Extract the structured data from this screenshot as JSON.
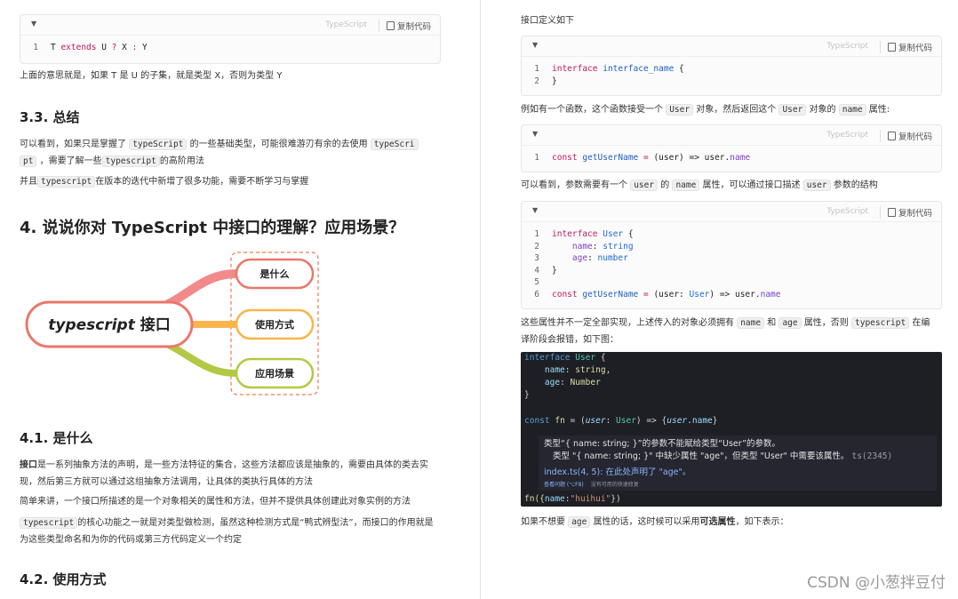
{
  "codeblock_common": {
    "lang": "TypeScript",
    "copy": "复制代码"
  },
  "left": {
    "code1": {
      "line_no": "1",
      "tokens": [
        "T ",
        "extends",
        " U ",
        "?",
        " X ",
        ":",
        " Y"
      ]
    },
    "p1": "上面的意思就是，如果 T 是 U 的子集，就是类型 X，否则为类型 Y",
    "h_3_3": "3.3. 总结",
    "p2_a": "可以看到，如果只是掌握了",
    "p2_code1": "typeScript",
    "p2_b": "的一些基础类型，可能很难游刃有余的去使用",
    "p2_code2a": "typeScri",
    "p2_code2b": "pt",
    "p2_c": "，需要了解一些",
    "p2_code3": "typescript",
    "p2_d": "的高阶用法",
    "p3_a": "并且",
    "p3_code": "typescript",
    "p3_b": "在版本的迭代中新增了很多功能，需要不断学习与掌握",
    "h_4": "4. 说说你对 TypeScript 中接口的理解？应用场景？",
    "mindmap": {
      "root_a": "typescript",
      "root_b": " 接口",
      "n1": "是什么",
      "n2": "使用方式",
      "n3": "应用场景"
    },
    "h_4_1": "4.1. 是什么",
    "p4_bold": "接口",
    "p4_rest": "是一系列抽象方法的声明，是一些方法特征的集合，这些方法都应该是抽象的，需要由具体的类去实现，然后第三方就可以通过这组抽象方法调用，让具体的类执行具体的方法",
    "p5": "简单来讲，一个接口所描述的是一个对象相关的属性和方法，但并不提供具体创建此对象实例的方法",
    "p6_code": "typescript",
    "p6_rest": "的核心功能之一就是对类型做检测，虽然这种检测方式是“鸭式辨型法”，而接口的作用就是为这些类型命名和为你的代码或第三方代码定义一个约定",
    "h_4_2": "4.2. 使用方式"
  },
  "right": {
    "p1": "接口定义如下",
    "code2": {
      "l1": [
        "interface",
        " ",
        "interface_name",
        " {"
      ],
      "l2": "}"
    },
    "p2_a": "例如有一个函数，这个函数接受一个",
    "p2_c1": "User",
    "p2_b": "对象，然后返回这个",
    "p2_c2": "User",
    "p2_c": "对象的",
    "p2_c3": "name",
    "p2_d": "属性:",
    "code3": {
      "tokens": [
        "const",
        " ",
        "getUserName",
        " ",
        "=",
        " (user) => user.",
        "name"
      ]
    },
    "p3_a": "可以看到，参数需要有一个",
    "p3_c1": "user",
    "p3_b": "的",
    "p3_c2": "name",
    "p3_c": "属性，可以通过接口描述",
    "p3_c3": "user",
    "p3_d": "参数的结构",
    "code4": {
      "l1": [
        "interface",
        " ",
        "User",
        " {"
      ],
      "l2": [
        "name",
        ": ",
        "string"
      ],
      "l3": [
        "age",
        ": ",
        "number"
      ],
      "l4": "}",
      "l6": [
        "const",
        " ",
        "getUserName",
        " ",
        "=",
        " (user: ",
        "User",
        ") => user.",
        "name"
      ]
    },
    "p4_a": "这些属性并不一定全部实现，上述传入的对象必须拥有",
    "p4_c1": "name",
    "p4_b": "和",
    "p4_c2": "age",
    "p4_c": "属性，否则",
    "p4_c3": "typescript",
    "p4_d": "在编",
    "p4_e": "译阶段会报错，如下图：",
    "editor": {
      "l1": [
        "interface",
        " ",
        "User",
        " {"
      ],
      "l2": [
        "name",
        ": ",
        "string",
        ","
      ],
      "l3": [
        "age",
        ": ",
        "Number"
      ],
      "l4": "}",
      "l6": [
        "const",
        " ",
        "fn",
        " = (",
        "user",
        ": ",
        "User",
        ") => {",
        "user",
        ".",
        "name",
        "}"
      ],
      "tip1": "类型“{ name: string; }”的参数不能赋给类型“User”的参数。",
      "tip2": "类型 \"{ name: string; }\" 中缺少属性 \"age\"，但类型 \"User\" 中需要该属性。",
      "tip2_code": "ts(2345)",
      "tip3": "index.ts(4, 5): 在此处声明了 \"age\"。",
      "tip_foot_a": "查看问题 (⌥F8)",
      "tip_foot_b": "没有可用的快速修复",
      "l_last": [
        "fn({",
        "name",
        ":",
        "\"huihui\"",
        "})"
      ]
    },
    "p5_a": "如果不想要",
    "p5_c": "age",
    "p5_b": "属性的话，这时候可以采用",
    "p5_bold": "可选属性",
    "p5_d": "，如下表示："
  },
  "watermark": "CSDN @小葱拌豆付"
}
